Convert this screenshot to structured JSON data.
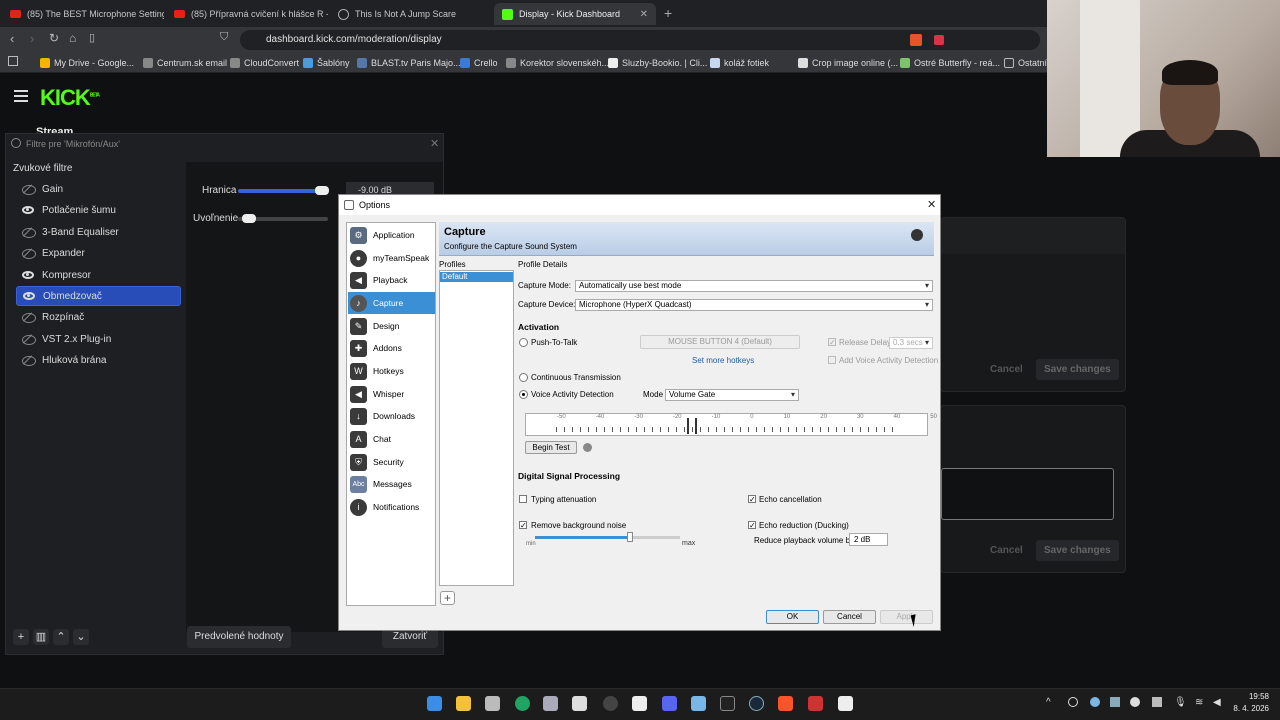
{
  "browser": {
    "tabs": [
      {
        "title": "(85) The BEST Microphone Setting fo",
        "icon": "youtube-icon"
      },
      {
        "title": "(85) Přípravná cvičení k hlášce R - Yo",
        "icon": "youtube-icon"
      },
      {
        "title": "This Is Not A Jump Scare",
        "icon": "globe-icon"
      },
      {
        "title": "Display - Kick Dashboard",
        "icon": "kick-icon",
        "active": true
      }
    ],
    "url": "dashboard.kick.com/moderation/display",
    "bookmarks": [
      "My Drive - Google...",
      "Centrum.sk email",
      "CloudConvert",
      "Šablóny",
      "BLAST.tv Paris Majo...",
      "Crello",
      "Korektor slovenskéh...",
      "Sluzby-Bookio. | Cli...",
      "koláž fotiek",
      "Crop image online (...",
      "Ostré Butterfly - reá...",
      "Ostatní"
    ]
  },
  "kick": {
    "logo": "KICK",
    "logo_badge": "BETA",
    "section_title": "Stream",
    "cancel_label": "Cancel",
    "save_label": "Save changes"
  },
  "obs": {
    "title": "Filtre pre 'Mikrofón/Aux'",
    "section": "Zvukové filtre",
    "filters": [
      {
        "name": "Gain",
        "visible": false
      },
      {
        "name": "Potlačenie šumu",
        "visible": true
      },
      {
        "name": "3-Band Equaliser",
        "visible": false
      },
      {
        "name": "Expander",
        "visible": false
      },
      {
        "name": "Kompresor",
        "visible": true
      },
      {
        "name": "Obmedzovač",
        "visible": true,
        "selected": true
      },
      {
        "name": "Rozpínač",
        "visible": false
      },
      {
        "name": "VST 2.x Plug-in",
        "visible": false
      },
      {
        "name": "Hluková brána",
        "visible": false
      }
    ],
    "threshold_label": "Hranica",
    "threshold_value": "-9.00 dB",
    "release_label": "Uvoľnenie",
    "defaults_button": "Predvolené hodnoty",
    "close_button": "Zatvoriť"
  },
  "options": {
    "title": "Options",
    "nav": [
      "Application",
      "myTeamSpeak",
      "Playback",
      "Capture",
      "Design",
      "Addons",
      "Hotkeys",
      "Whisper",
      "Downloads",
      "Chat",
      "Security",
      "Messages",
      "Notifications"
    ],
    "nav_selected": "Capture",
    "header_title": "Capture",
    "header_sub": "Configure the Capture Sound System",
    "profiles_label": "Profiles",
    "profile_default": "Default",
    "details_label": "Profile Details",
    "capture_mode_label": "Capture Mode:",
    "capture_mode_value": "Automatically use best mode",
    "capture_device_label": "Capture Device:",
    "capture_device_value": "Microphone (HyperX Quadcast)",
    "activation_header": "Activation",
    "ptt_label": "Push-To-Talk",
    "mouse_button": "MOUSE BUTTON 4 (Default)",
    "release_delay_label": "Release Delay",
    "release_delay_value": "0.3 secs",
    "set_hotkeys": "Set more hotkeys",
    "add_vad_label": "Add Voice Activity Detection",
    "continuous_label": "Continuous Transmission",
    "vad_label": "Voice Activity Detection",
    "mode_label": "Mode",
    "mode_value": "Volume Gate",
    "meter_ticks": [
      "-50",
      "-40",
      "-30",
      "-20",
      "-10",
      "0",
      "10",
      "20",
      "30",
      "40",
      "50"
    ],
    "begin_test": "Begin Test",
    "dsp_header": "Digital Signal Processing",
    "typing_label": "Typing attenuation",
    "echo_cancel_label": "Echo cancellation",
    "remove_noise_label": "Remove background noise",
    "echo_reduction_label": "Echo reduction (Ducking)",
    "reduce_label": "Reduce playback volume by:",
    "reduce_value": "2 dB",
    "min_label": "min",
    "max_label": "max",
    "ok": "OK",
    "cancel": "Cancel",
    "apply": "Apply"
  },
  "taskbar": {
    "time": "19:58",
    "date": "8. 4. 2026"
  }
}
